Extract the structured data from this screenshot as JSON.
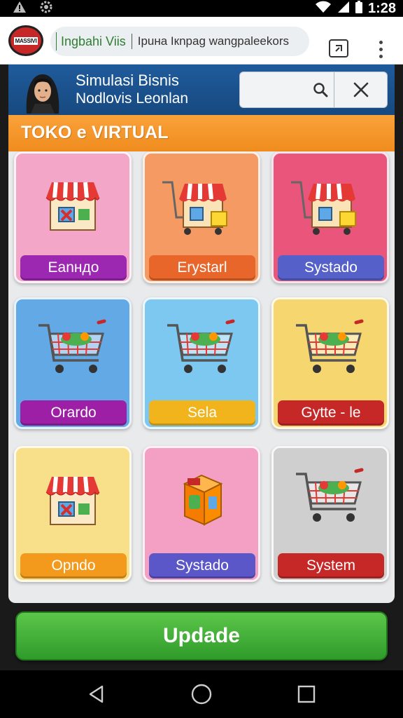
{
  "status_bar": {
    "time": "1:28",
    "icons": [
      "warning-icon",
      "settings-icon",
      "wifi-icon",
      "signal-icon",
      "battery-icon"
    ]
  },
  "browser": {
    "url_domain": "Ingbahi Viis",
    "url_path": "Ipuнa Iкnpag wangpaleekors",
    "logo_text": "MASSIVI",
    "tab_count_icon": "tab-switcher-icon",
    "menu_icon": "more-vert-icon"
  },
  "app": {
    "title_line1": "Simulasi Bisnis",
    "title_line2": "Nodlovis Leonlan",
    "search_icon": "search-icon",
    "close_icon": "close-icon",
    "section_title": "TOKO e VIRTUAL",
    "tiles": [
      {
        "label": "Eanндo",
        "icon": "store-icon",
        "bg": "#f3a6c8",
        "label_color": "#9c27b0"
      },
      {
        "label": "Erystarl",
        "icon": "store-cart-icon",
        "bg": "#f59a63",
        "label_color": "#e8662a"
      },
      {
        "label": "Systado",
        "icon": "store-cart-icon",
        "bg": "#e9557b",
        "label_color": "#5561c9"
      },
      {
        "label": "Orardo",
        "icon": "shopping-cart-icon",
        "bg": "#62a9e6",
        "label_color": "#9d1fa5"
      },
      {
        "label": "Sela",
        "icon": "shopping-cart-icon",
        "bg": "#7cc8f0",
        "label_color": "#f2b41d"
      },
      {
        "label": "Gytte - le",
        "icon": "shopping-cart-icon",
        "bg": "#f6d66f",
        "label_color": "#c62828"
      },
      {
        "label": "Opndo",
        "icon": "store-icon",
        "bg": "#f8e08a",
        "label_color": "#f39a1c"
      },
      {
        "label": "Systado",
        "icon": "box-icon",
        "bg": "#f3a0c4",
        "label_color": "#5b57c9"
      },
      {
        "label": "System",
        "icon": "shopping-cart-icon",
        "bg": "#cfcfcf",
        "label_color": "#c62828"
      }
    ],
    "update_label": "Updade"
  },
  "nav": {
    "back_icon": "back-icon",
    "home_icon": "home-icon",
    "recents_icon": "recents-icon"
  }
}
